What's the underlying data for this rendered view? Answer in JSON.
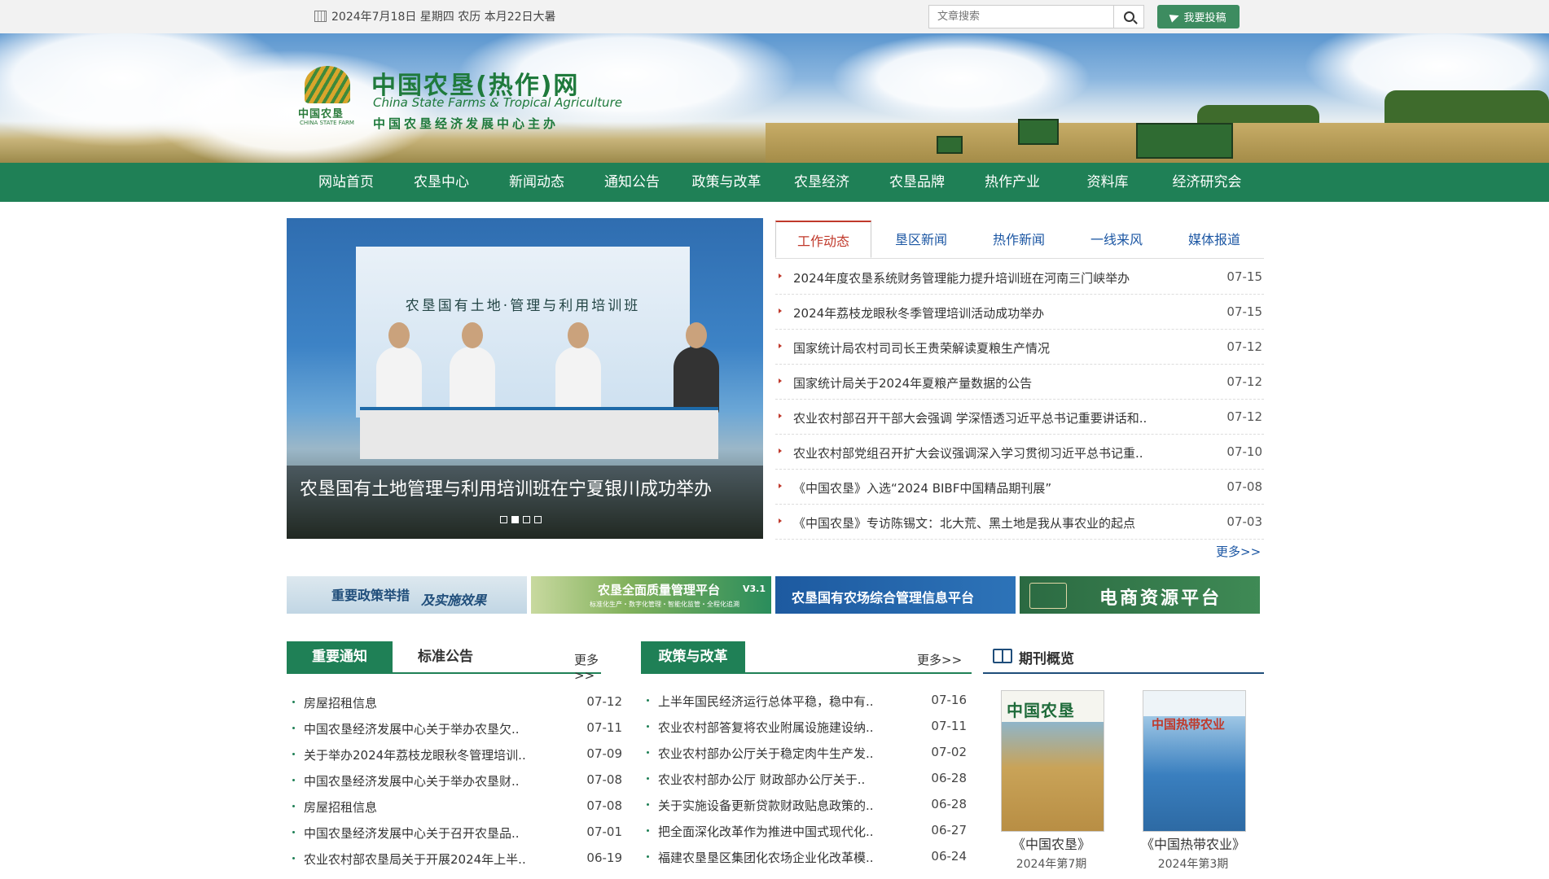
{
  "topbar": {
    "date": "2024年7月18日 星期四 农历 本月22日大暑",
    "search_placeholder": "文章搜索",
    "submit_label": "我要投稿"
  },
  "header": {
    "logo_cn": "中国农垦",
    "logo_en": "CHINA STATE FARM",
    "site_name": "中国农垦(热作)网",
    "site_en": "China State Farms & Tropical Agriculture",
    "site_sub": "中国农垦经济发展中心主办"
  },
  "nav": [
    "网站首页",
    "农垦中心",
    "新闻动态",
    "通知公告",
    "政策与改革",
    "农垦经济",
    "农垦品牌",
    "热作产业",
    "资料库",
    "经济研究会"
  ],
  "slider": {
    "screen_text": "农垦国有土地·管理与利用培训班",
    "title": "农垦国有土地管理与利用培训班在宁夏银川成功举办",
    "slides": 4,
    "active_slide": 2
  },
  "news_tabs": [
    "工作动态",
    "垦区新闻",
    "热作新闻",
    "一线来风",
    "媒体报道"
  ],
  "news_active_tab": "工作动态",
  "news": [
    {
      "title": "2024年度农垦系统财务管理能力提升培训班在河南三门峡举办",
      "date": "07-15"
    },
    {
      "title": "2024年荔枝龙眼秋冬季管理培训活动成功举办",
      "date": "07-15"
    },
    {
      "title": "国家统计局农村司司长王贵荣解读夏粮生产情况",
      "date": "07-12"
    },
    {
      "title": "国家统计局关于2024年夏粮产量数据的公告",
      "date": "07-12"
    },
    {
      "title": "农业农村部召开干部大会强调 学深悟透习近平总书记重要讲话和..",
      "date": "07-12"
    },
    {
      "title": "农业农村部党组召开扩大会议强调深入学习贯彻习近平总书记重..",
      "date": "07-10"
    },
    {
      "title": "《中国农垦》入选“2024 BIBF中国精品期刊展”",
      "date": "07-08"
    },
    {
      "title": "《中国农垦》专访陈锡文：北大荒、黑土地是我从事农业的起点",
      "date": "07-03"
    }
  ],
  "more_label": "更多>>",
  "promos": {
    "p1_a": "重要政策举措",
    "p1_b": "及实施效果",
    "p2_title": "农垦全面质量管理平台",
    "p2_ver": "V3.1",
    "p2_sub": "标准化生产・数字化管理・智能化监管・全程化追溯",
    "p3": "农垦国有农场综合管理信息平台",
    "p4": "电商资源平台"
  },
  "notices": {
    "tab_active": "重要通知",
    "tab_other": "标准公告",
    "more": "更多>>",
    "items": [
      {
        "title": "房屋招租信息",
        "date": "07-12"
      },
      {
        "title": "中国农垦经济发展中心关于举办农垦欠..",
        "date": "07-11"
      },
      {
        "title": "关于举办2024年荔枝龙眼秋冬管理培训..",
        "date": "07-09"
      },
      {
        "title": "中国农垦经济发展中心关于举办农垦财..",
        "date": "07-08"
      },
      {
        "title": "房屋招租信息",
        "date": "07-08"
      },
      {
        "title": "中国农垦经济发展中心关于召开农垦品..",
        "date": "07-01"
      },
      {
        "title": "农业农村部农垦局关于开展2024年上半..",
        "date": "06-19"
      }
    ]
  },
  "policy": {
    "tab": "政策与改革",
    "more": "更多>>",
    "items": [
      {
        "title": "上半年国民经济运行总体平稳，稳中有..",
        "date": "07-16"
      },
      {
        "title": "农业农村部答复将农业附属设施建设纳..",
        "date": "07-11"
      },
      {
        "title": "农业农村部办公厅关于稳定肉牛生产发..",
        "date": "07-02"
      },
      {
        "title": "农业农村部办公厅 财政部办公厅关于..",
        "date": "06-28"
      },
      {
        "title": "关于实施设备更新贷款财政贴息政策的..",
        "date": "06-28"
      },
      {
        "title": "把全面深化改革作为推进中国式现代化..",
        "date": "06-27"
      },
      {
        "title": "福建农垦垦区集团化农场企业化改革模..",
        "date": "06-24"
      }
    ]
  },
  "magazines": {
    "title": "期刊概览",
    "items": [
      {
        "cover_text": "中国农垦",
        "name": "《中国农垦》",
        "issue": "2024年第7期"
      },
      {
        "cover_text": "中国热带农业",
        "name": "《中国热带农业》",
        "issue": "2024年第3期"
      }
    ]
  },
  "colors": {
    "nav_green": "#1f8056",
    "accent_red": "#c0392b",
    "link_blue": "#1b56a3"
  }
}
